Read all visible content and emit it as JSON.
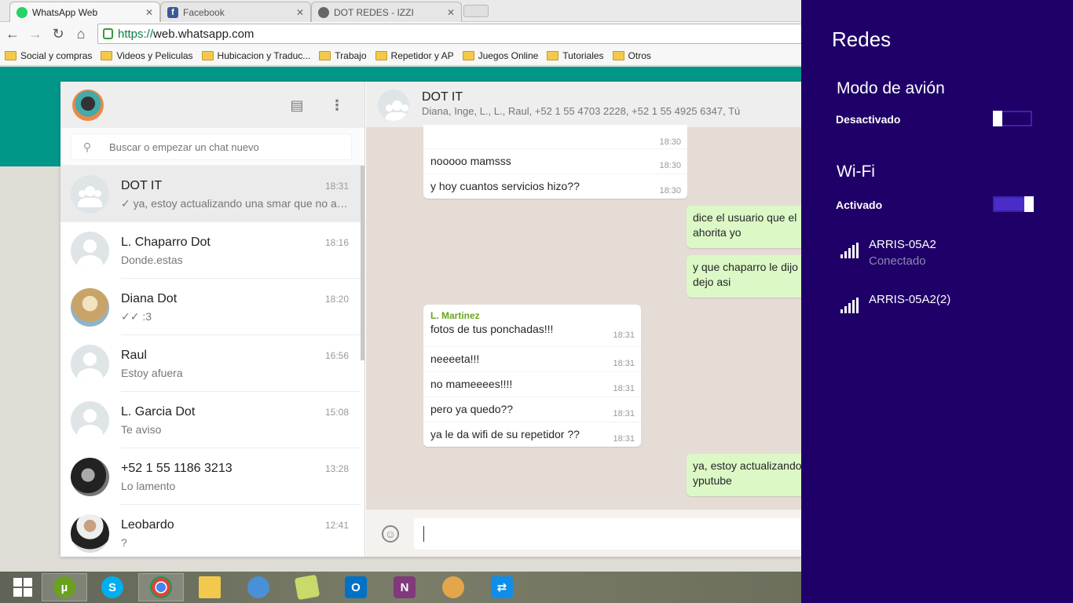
{
  "browser": {
    "tabs": [
      {
        "title": "WhatsApp Web",
        "active": true,
        "favicon_color": "#25d366"
      },
      {
        "title": "Facebook",
        "active": false,
        "favicon_color": "#3b5998"
      },
      {
        "title": "DOT REDES - IZZI",
        "active": false,
        "favicon_color": "#555555"
      }
    ],
    "url_scheme": "https://",
    "url_rest": "web.whatsapp.com",
    "bookmarks": [
      "Social y compras",
      "Videos y Peliculas",
      "Hubicacion y Traduc...",
      "Trabajo",
      "Repetidor y AP",
      "Juegos Online",
      "Tutoriales",
      "Otros"
    ]
  },
  "sidebar": {
    "search_placeholder": "Buscar o empezar un chat nuevo",
    "chats": [
      {
        "name": "DOT IT",
        "time": "18:31",
        "message": "✓ ya, estoy actualizando una smar que no ab...",
        "avatar": "group"
      },
      {
        "name": "L. Chaparro Dot",
        "time": "18:16",
        "message": "Donde.estas",
        "avatar": "default"
      },
      {
        "name": "Diana Dot",
        "time": "18:20",
        "message": "✓✓ :3",
        "avatar": "photo"
      },
      {
        "name": "Raul",
        "time": "16:56",
        "message": "Estoy afuera",
        "avatar": "default"
      },
      {
        "name": "L. Garcia Dot",
        "time": "15:08",
        "message": "Te aviso",
        "avatar": "default"
      },
      {
        "name": "+52 1 55 1186 3213",
        "time": "13:28",
        "message": "Lo lamento",
        "avatar": "photo"
      },
      {
        "name": "Leobardo",
        "time": "12:41",
        "message": "?",
        "avatar": "photo"
      }
    ]
  },
  "conversation": {
    "title": "DOT IT",
    "participants": "Diana, Inge, L., L., Raul, +52 1 55 4703 2228, +52 1 55 4925 6347, Tú",
    "group1": {
      "lines": [
        {
          "text": "",
          "time": "18:30"
        },
        {
          "text": "nooooo mamsss",
          "time": "18:30"
        },
        {
          "text": "y hoy cuantos servicios hizo??",
          "time": "18:30"
        }
      ]
    },
    "out1": {
      "line1": "dice el usuario que el",
      "line2": "ahorita yo"
    },
    "out2": {
      "line1": "y que chaparro le dijo",
      "line2": "dejo asi"
    },
    "group2": {
      "sender": "L. Martinez",
      "lines": [
        {
          "text": "fotos de tus ponchadas!!!",
          "time": "18:31"
        },
        {
          "text": "neeeeta!!!",
          "time": "18:31"
        },
        {
          "text": "no mameeees!!!!",
          "time": "18:31"
        },
        {
          "text": "pero ya quedo??",
          "time": "18:31"
        },
        {
          "text": "ya le da wifi de su repetidor ??",
          "time": "18:31"
        }
      ]
    },
    "out3": {
      "line1": "ya, estoy actualizando",
      "line2": "yputube"
    }
  },
  "taskbar": {
    "apps": [
      {
        "name": "start",
        "color": "#ffffff"
      },
      {
        "name": "utorrent",
        "color": "#6aa121"
      },
      {
        "name": "skype",
        "color": "#00aff0"
      },
      {
        "name": "chrome",
        "color": "#db4437"
      },
      {
        "name": "file-explorer",
        "color": "#f2c94c"
      },
      {
        "name": "network-tool",
        "color": "#4a90d9"
      },
      {
        "name": "sticky",
        "color": "#c9d96a"
      },
      {
        "name": "outlook",
        "color": "#0072c6"
      },
      {
        "name": "onenote",
        "color": "#80397b"
      },
      {
        "name": "paint",
        "color": "#e5a54a"
      },
      {
        "name": "teamviewer",
        "color": "#0e8ee9"
      }
    ]
  },
  "networks_panel": {
    "title": "Redes",
    "airplane_label": "Modo de avión",
    "airplane_state": "Desactivado",
    "wifi_label": "Wi-Fi",
    "wifi_state": "Activado",
    "networks": [
      {
        "name": "ARRIS-05A2",
        "status": "Conectado"
      },
      {
        "name": "ARRIS-05A2(2)",
        "status": ""
      }
    ]
  }
}
